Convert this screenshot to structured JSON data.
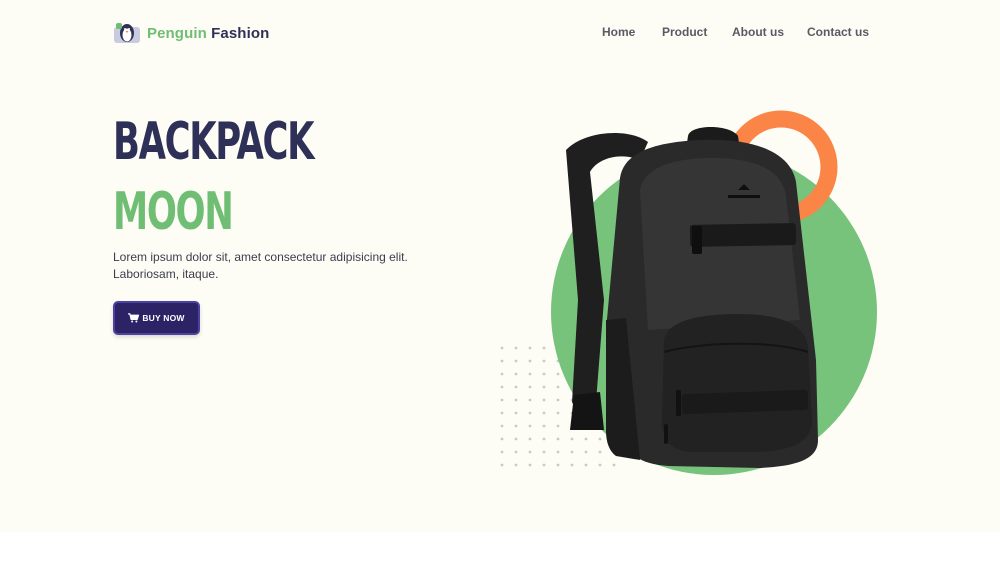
{
  "brand": {
    "word1": "Penguin",
    "word2": "Fashion",
    "logo_icon": "penguin-logo-icon"
  },
  "nav": {
    "items": [
      {
        "label": "Home"
      },
      {
        "label": "Product"
      },
      {
        "label": "About us"
      },
      {
        "label": "Contact us"
      }
    ]
  },
  "hero": {
    "title_line1": "BACKPACK",
    "title_line2": "MOON",
    "description": "Lorem ipsum dolor sit, amet consectetur adipisicing elit. Laboriosam, itaque.",
    "cta_label": "BUY NOW",
    "cta_icon": "cart-icon",
    "image": "black-backpack-image"
  },
  "colors": {
    "background": "#fdfdf5",
    "brand_green": "#6fbe74",
    "navy": "#2f3057",
    "button": "#2b2366",
    "accent_orange": "#fb8447",
    "circle_green": "#77c37c"
  }
}
